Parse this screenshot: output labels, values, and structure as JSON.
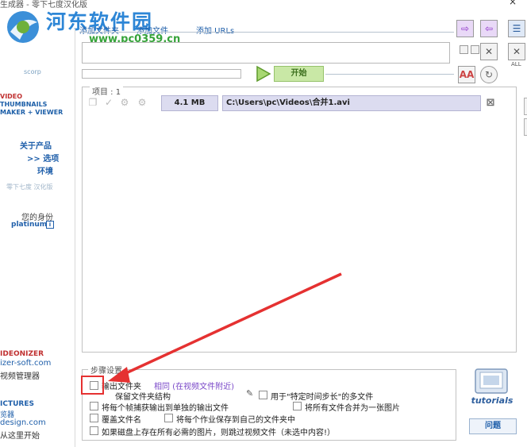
{
  "window": {
    "title": "生成器 - 零下七度汉化版",
    "close_glyph": "×"
  },
  "watermark": {
    "site_name": "河东软件园",
    "url": "www.pc0359.cn"
  },
  "sidebar": {
    "scorp": "scorp",
    "brand_line1": "VIDEO",
    "brand_line2": "THUMBNAILS",
    "brand_line3": "MAKER + VIEWER",
    "nav_about": "关于产品",
    "nav_options": ">> 选项",
    "nav_env": "环境",
    "faded_text": "零下七度 汉化版",
    "identity_label": "您的身份",
    "identity_value": "platinum",
    "identity_info": "i",
    "promo1_name": "IDEONIZER",
    "promo1_site": "izer-soft.com",
    "promo1_desc": "视频管理器",
    "promo2_name": "ICTURES",
    "promo2_sub": "览器",
    "promo2_site": "design.com",
    "promo2_desc": "从这里开始"
  },
  "toolbar": {
    "add_folder": "添加文件夹",
    "add_file": "添加文件",
    "add_urls": "添加 URLs"
  },
  "start_button": "开始",
  "progress_value": 0.0,
  "file_list": {
    "label": "项目 : 1",
    "items": [
      {
        "size": "4.1 MB",
        "path": "C:\\Users\\pc\\Videos\\合并1.avi"
      }
    ]
  },
  "right_toolbar": {
    "all_label": "ALL",
    "font_label": "AA"
  },
  "output_settings": {
    "label": "步骤设置",
    "output_folder": "输出文件夹",
    "same_as_video": "相同 (在视频文件附近)",
    "keep_structure": "保留文件夹结构",
    "fixed_step": "用于\"特定时间步长\"的多文件",
    "each_frame_separate": "将每个帧捕获输出到单独的输出文件",
    "merge_all": "将所有文件合并为一张图片",
    "overwrite": "覆盖文件名",
    "own_folder": "将每个作业保存到自己的文件夹中",
    "disk_option": "如果磁盘上存在所有必需的图片，则跳过视频文件（未选中内容!）"
  },
  "tutorials_label": "tutorials",
  "help_button": "问题",
  "colors": {
    "accent_blue": "#1f5faa",
    "start_green": "#c9e8a6",
    "annotation_red": "#e53131",
    "move_purple": "#8b2fc7"
  }
}
